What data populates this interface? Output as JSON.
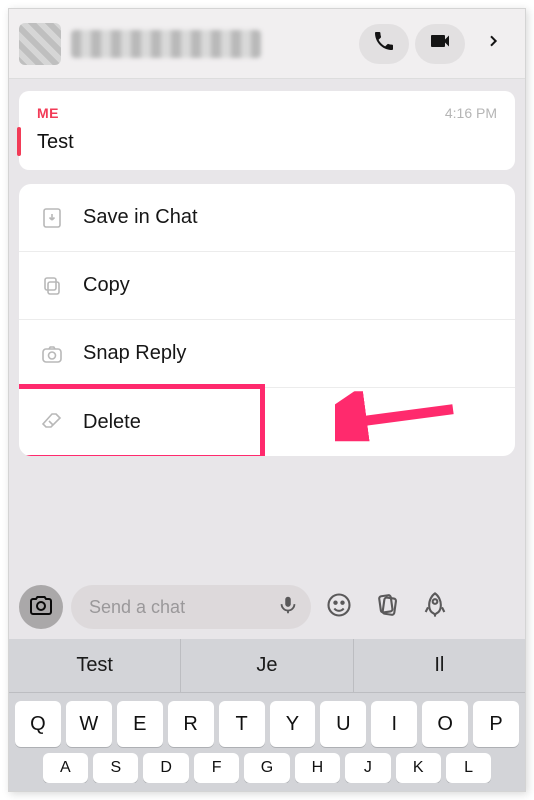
{
  "message": {
    "sender_label": "ME",
    "timestamp": "4:16 PM",
    "text": "Test"
  },
  "context_menu": {
    "save": "Save in Chat",
    "copy": "Copy",
    "snap_reply": "Snap Reply",
    "delete": "Delete"
  },
  "input": {
    "placeholder": "Send a chat"
  },
  "keyboard": {
    "suggestions": [
      "Test",
      "Je",
      "Il"
    ],
    "row1": [
      "Q",
      "W",
      "E",
      "R",
      "T",
      "Y",
      "U",
      "I",
      "O",
      "P"
    ],
    "row2": [
      "A",
      "S",
      "D",
      "F",
      "G",
      "H",
      "J",
      "K",
      "L"
    ]
  },
  "colors": {
    "accent": "#f23b57",
    "highlight": "#ff2a6d"
  }
}
